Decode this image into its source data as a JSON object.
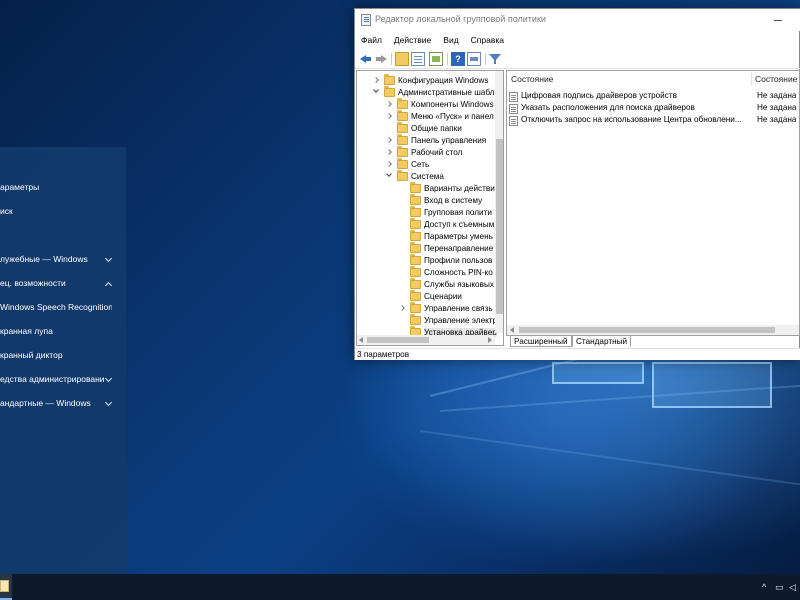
{
  "start_menu": {
    "items": [
      {
        "label": "араметры",
        "chevron": ""
      },
      {
        "label": "иск",
        "chevron": ""
      },
      {
        "label": "лужебные — Windows",
        "chevron": "down"
      },
      {
        "label": "ец. возможности",
        "chevron": "up"
      },
      {
        "label": "Windows Speech Recognition",
        "chevron": ""
      },
      {
        "label": "кранная лупа",
        "chevron": ""
      },
      {
        "label": "кранный диктор",
        "chevron": ""
      },
      {
        "label": "едства администрировани...",
        "chevron": "down"
      },
      {
        "label": "андартные — Windows",
        "chevron": "down"
      }
    ]
  },
  "window": {
    "title": "Редактор локальной групповой политики",
    "menu": [
      "Файл",
      "Действие",
      "Вид",
      "Справка"
    ],
    "toolbar_icons": [
      "back-arrow-icon",
      "forward-arrow-icon",
      "up-folder-icon",
      "show-hide-tree-icon",
      "export-list-icon",
      "help-icon",
      "properties-icon",
      "filter-icon"
    ],
    "tree": [
      {
        "label": "Конфигурация Windows",
        "level": 1,
        "state": "collapsed",
        "selected": false
      },
      {
        "label": "Административные шабл",
        "level": 1,
        "state": "expanded",
        "selected": false
      },
      {
        "label": "Компоненты Windows",
        "level": 2,
        "state": "collapsed",
        "selected": false
      },
      {
        "label": "Меню «Пуск» и панел",
        "level": 2,
        "state": "collapsed",
        "selected": false
      },
      {
        "label": "Общие папки",
        "level": 2,
        "state": "none",
        "selected": false
      },
      {
        "label": "Панель управления",
        "level": 2,
        "state": "collapsed",
        "selected": false
      },
      {
        "label": "Рабочий стол",
        "level": 2,
        "state": "collapsed",
        "selected": false
      },
      {
        "label": "Сеть",
        "level": 2,
        "state": "collapsed",
        "selected": false
      },
      {
        "label": "Система",
        "level": 2,
        "state": "expanded",
        "selected": false
      },
      {
        "label": "Варианты действи",
        "level": 3,
        "state": "none",
        "selected": false
      },
      {
        "label": "Вход в систему",
        "level": 3,
        "state": "none",
        "selected": false
      },
      {
        "label": "Групповая полити",
        "level": 3,
        "state": "none",
        "selected": false
      },
      {
        "label": "Доступ к съемным",
        "level": 3,
        "state": "none",
        "selected": false
      },
      {
        "label": "Параметры умень",
        "level": 3,
        "state": "none",
        "selected": false
      },
      {
        "label": "Перенаправление",
        "level": 3,
        "state": "none",
        "selected": false
      },
      {
        "label": "Профили пользов",
        "level": 3,
        "state": "none",
        "selected": false
      },
      {
        "label": "Сложность PIN-ко",
        "level": 3,
        "state": "none",
        "selected": false
      },
      {
        "label": "Службы языковых",
        "level": 3,
        "state": "none",
        "selected": false
      },
      {
        "label": "Сценарии",
        "level": 3,
        "state": "none",
        "selected": false
      },
      {
        "label": "Управление связь",
        "level": 3,
        "state": "collapsed",
        "selected": false
      },
      {
        "label": "Управление электр",
        "level": 3,
        "state": "none",
        "selected": false
      },
      {
        "label": "Установка драйвер",
        "level": 3,
        "state": "none",
        "selected": true
      }
    ],
    "content": {
      "columns": {
        "name": "Состояние",
        "state": "Состояние"
      },
      "rows": [
        {
          "name": "Цифровая подпись драйверов устройств",
          "state": "Не задана"
        },
        {
          "name": "Указать расположения для поиска драйверов",
          "state": "Не задана"
        },
        {
          "name": "Отключить запрос на использование Центра обновлени...",
          "state": "Не задана"
        }
      ]
    },
    "tabs": [
      "Расширенный",
      "Стандартный"
    ],
    "active_tab": "Стандартный",
    "status": "3 параметров"
  },
  "taskbar": {
    "tray_icons": [
      "show-desktop-chevron-icon",
      "network-icon",
      "volume-icon"
    ]
  }
}
